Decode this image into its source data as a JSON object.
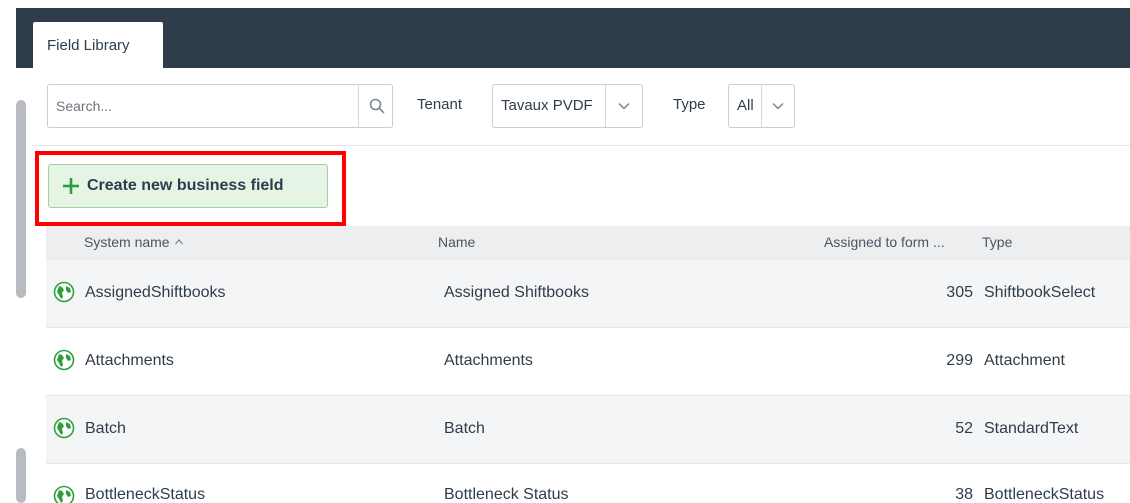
{
  "tabs": [
    {
      "label": "Field Library",
      "active": true
    }
  ],
  "filters": {
    "search_placeholder": "Search...",
    "tenant_label": "Tenant",
    "tenant_value": "Tavaux PVDF",
    "type_label": "Type",
    "type_value": "All"
  },
  "actions": {
    "create_label": "Create new business field"
  },
  "table": {
    "columns": [
      "System name",
      "Name",
      "Assigned to form ...",
      "Type"
    ],
    "sorted_column": "System name",
    "sort_direction": "ascending",
    "rows": [
      {
        "system_name": "AssignedShiftbooks",
        "name": "Assigned Shiftbooks",
        "assigned": "305",
        "type": "ShiftbookSelect"
      },
      {
        "system_name": "Attachments",
        "name": "Attachments",
        "assigned": "299",
        "type": "Attachment"
      },
      {
        "system_name": "Batch",
        "name": "Batch",
        "assigned": "52",
        "type": "StandardText"
      },
      {
        "system_name": "BottleneckStatus",
        "name": "Bottleneck Status",
        "assigned": "38",
        "type": "BottleneckStatus"
      }
    ]
  },
  "colors": {
    "header_dark": "#2f3d4b",
    "create_bg": "#e6f4e6",
    "create_plus": "#2e9e3e",
    "highlight": "#ff0000",
    "globe": "#2e9e3e"
  }
}
